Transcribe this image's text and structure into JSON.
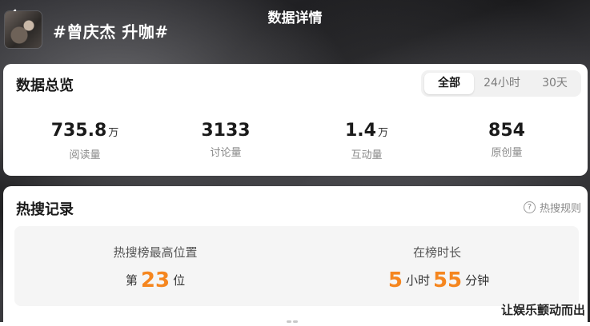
{
  "header": {
    "title": "数据详情",
    "topic": "#曾庆杰 升咖#"
  },
  "overview": {
    "title": "数据总览",
    "tabs": [
      {
        "label": "全部",
        "active": true
      },
      {
        "label": "24小时",
        "active": false
      },
      {
        "label": "30天",
        "active": false
      }
    ],
    "stats": [
      {
        "value": "735.8",
        "unit": "万",
        "label": "阅读量"
      },
      {
        "value": "3133",
        "unit": "",
        "label": "讨论量"
      },
      {
        "value": "1.4",
        "unit": "万",
        "label": "互动量"
      },
      {
        "value": "854",
        "unit": "",
        "label": "原创量"
      }
    ]
  },
  "hot": {
    "title": "热搜记录",
    "rules_label": "热搜规则",
    "best_position": {
      "label": "热搜榜最高位置",
      "prefix": "第",
      "value": "23",
      "suffix": "位"
    },
    "duration": {
      "label": "在榜时长",
      "hours": "5",
      "hours_unit": "小时",
      "minutes": "55",
      "minutes_unit": "分钟"
    }
  },
  "watermark": "让娱乐颤动而出",
  "colors": {
    "accent": "#f5861f",
    "header_bg": "#2a2a2e"
  }
}
